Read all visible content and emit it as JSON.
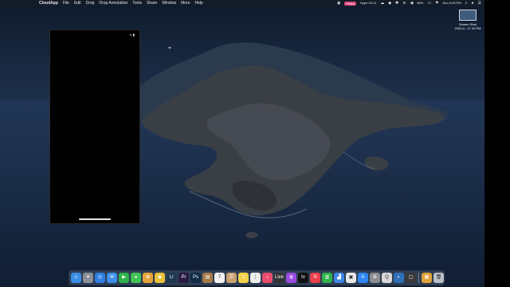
{
  "menubar": {
    "apple": "",
    "items": [
      "CloudApp",
      "File",
      "Edit",
      "Drop",
      "Drop Annotation",
      "Tools",
      "Share",
      "Window",
      "More",
      "Help"
    ],
    "record_badge": "Finish",
    "meter": "Hype 02:11",
    "battery": "89%",
    "clock": "Sun 5:29 PM"
  },
  "phone": {
    "status": "▪▪ ▮"
  },
  "desktop_icon": {
    "name_line1": "Screen Shot",
    "name_line2": "2020-0...27.43 PM"
  },
  "dock": {
    "apps": [
      {
        "name": "finder",
        "color": "#3a8ee6",
        "glyph": "☺"
      },
      {
        "name": "launchpad",
        "color": "#8a8f99",
        "glyph": "✦"
      },
      {
        "name": "safari",
        "color": "#2f7fe0",
        "glyph": "◎"
      },
      {
        "name": "mail",
        "color": "#3e8fe8",
        "glyph": "✉"
      },
      {
        "name": "facetime",
        "color": "#2fb24a",
        "glyph": "▶"
      },
      {
        "name": "messages",
        "color": "#41c354",
        "glyph": "●"
      },
      {
        "name": "photos",
        "color": "#e8a23a",
        "glyph": "✿"
      },
      {
        "name": "chrome",
        "color": "#e9c23a",
        "glyph": "◉"
      },
      {
        "name": "lightroom",
        "color": "#1e3a52",
        "glyph": "Lr"
      },
      {
        "name": "premiere",
        "color": "#2a1a45",
        "glyph": "Pr"
      },
      {
        "name": "photoshop",
        "color": "#0f2c45",
        "glyph": "Ps"
      },
      {
        "name": "files",
        "color": "#a67b4a",
        "glyph": "▤"
      },
      {
        "name": "calendar",
        "color": "#f2f2f2",
        "glyph": "7"
      },
      {
        "name": "contacts",
        "color": "#c8a070",
        "glyph": "☰"
      },
      {
        "name": "notes",
        "color": "#f3d24a",
        "glyph": "≡"
      },
      {
        "name": "reminders",
        "color": "#ececec",
        "glyph": "⋮"
      },
      {
        "name": "music",
        "color": "#ea4c6b",
        "glyph": "♪"
      },
      {
        "name": "live",
        "color": "#333333",
        "glyph": "Live"
      },
      {
        "name": "podcasts",
        "color": "#9a4ce0",
        "glyph": "◍"
      },
      {
        "name": "tv",
        "color": "#111111",
        "glyph": "tv"
      },
      {
        "name": "news",
        "color": "#e8404d",
        "glyph": "N"
      },
      {
        "name": "numbers",
        "color": "#2fb24a",
        "glyph": "▥"
      },
      {
        "name": "keynote",
        "color": "#3f86e8",
        "glyph": "▟"
      },
      {
        "name": "preview",
        "color": "#e8e8e8",
        "glyph": "▣"
      },
      {
        "name": "app-store",
        "color": "#2f86f0",
        "glyph": "A"
      },
      {
        "name": "system-preferences",
        "color": "#8e8e93",
        "glyph": "⚙"
      },
      {
        "name": "quicktime",
        "color": "#d8d8d8",
        "glyph": "Q"
      },
      {
        "name": "network-utility",
        "color": "#2f6fb8",
        "glyph": "◐"
      },
      {
        "name": "screenshot",
        "color": "#3a3a3a",
        "glyph": "▢"
      }
    ],
    "trailing": [
      {
        "name": "downloads-folder",
        "color": "#e0a23a",
        "glyph": "▦"
      },
      {
        "name": "trash",
        "color": "#b9c0c8",
        "glyph": "🗑"
      }
    ]
  }
}
